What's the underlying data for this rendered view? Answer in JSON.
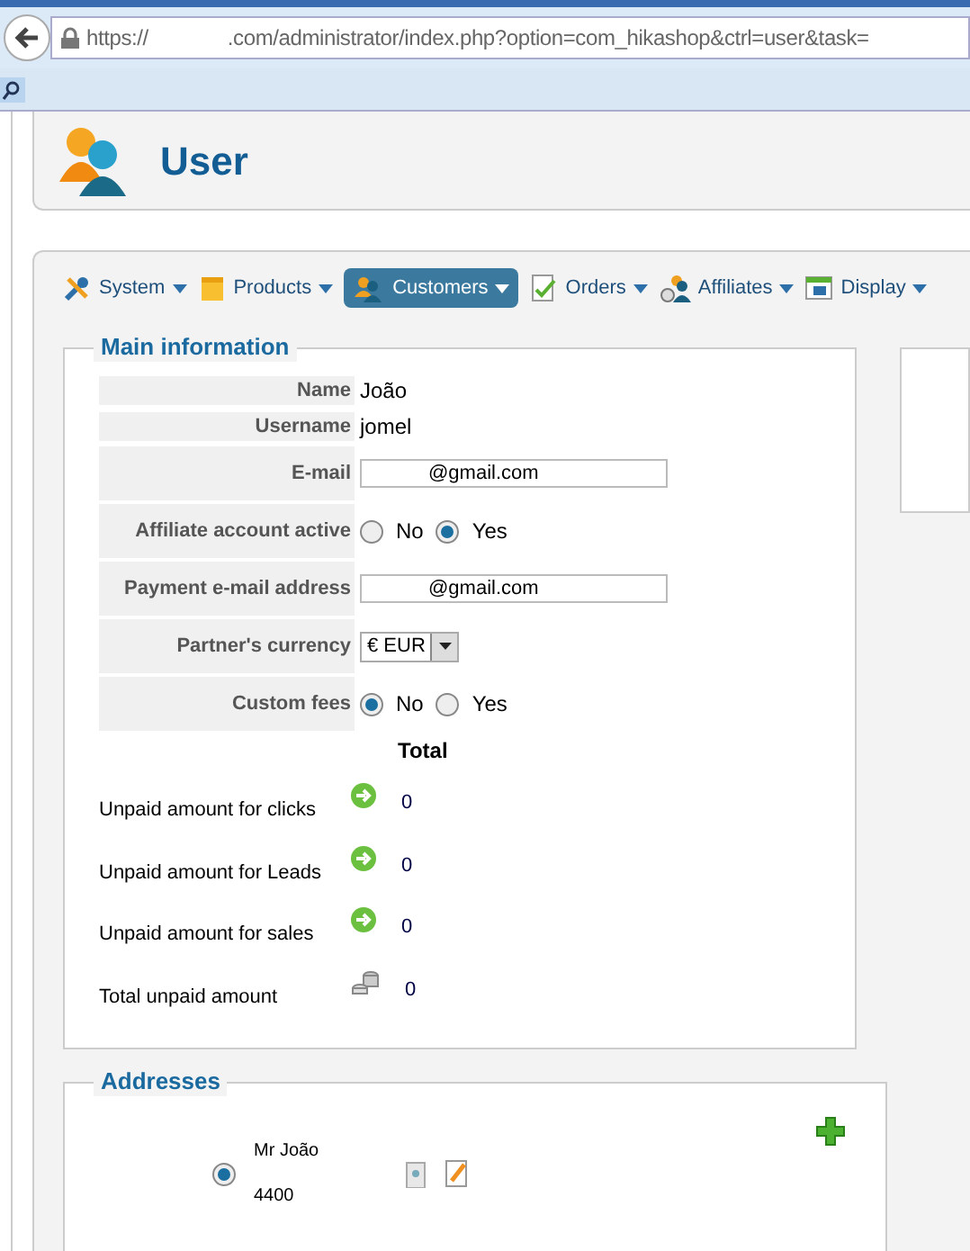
{
  "browser": {
    "url_scheme": "https://",
    "url_rest": ".com/administrator/index.php?option=com_hikashop&ctrl=user&task="
  },
  "header": {
    "title": "User"
  },
  "menu": [
    {
      "label": "System",
      "selected": false
    },
    {
      "label": "Products",
      "selected": false
    },
    {
      "label": "Customers",
      "selected": true
    },
    {
      "label": "Orders",
      "selected": false
    },
    {
      "label": "Affiliates",
      "selected": false
    },
    {
      "label": "Display",
      "selected": false
    }
  ],
  "main_information": {
    "legend": "Main information",
    "fields": [
      {
        "kind": "text",
        "label": "Name",
        "value": "João"
      },
      {
        "kind": "text",
        "label": "Username",
        "value": "jomel"
      },
      {
        "kind": "input",
        "label": "E-mail",
        "value": "@gmail.com"
      },
      {
        "kind": "radio",
        "label": "Affiliate account active",
        "options": [
          {
            "label": "No",
            "selected": false
          },
          {
            "label": "Yes",
            "selected": true
          }
        ]
      },
      {
        "kind": "input",
        "label": "Payment e-mail address",
        "value": "@gmail.com"
      },
      {
        "kind": "select",
        "label": "Partner's currency",
        "value": "€ EUR"
      },
      {
        "kind": "radio",
        "label": "Custom fees",
        "options": [
          {
            "label": "No",
            "selected": true
          },
          {
            "label": "Yes",
            "selected": false
          }
        ]
      }
    ],
    "totals_heading": "Total",
    "amounts": [
      {
        "label": "Unpaid amount for clicks",
        "value": "0"
      },
      {
        "label": "Unpaid amount for Leads",
        "value": "0"
      },
      {
        "label": "Unpaid amount for sales",
        "value": "0"
      },
      {
        "label": "Total unpaid amount",
        "value": "0"
      }
    ]
  },
  "addresses": {
    "legend": "Addresses",
    "items": [
      {
        "name": "Mr João",
        "code": "4400",
        "selected": true
      }
    ]
  }
}
